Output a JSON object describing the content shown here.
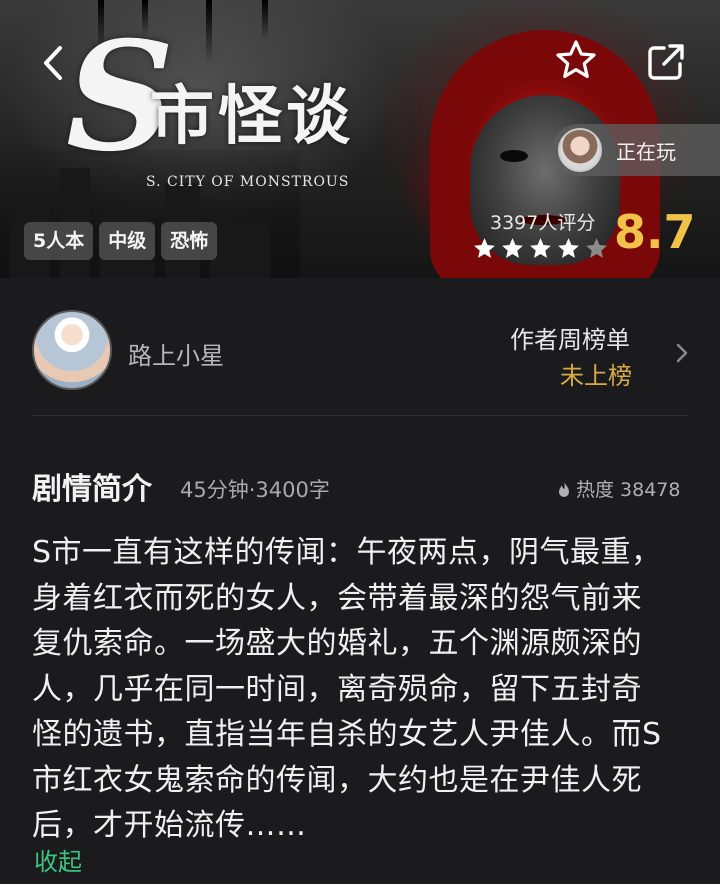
{
  "cover": {
    "logo_letter": "S",
    "logo_chinese": "市怪谈",
    "logo_english": "S. CITY OF MONSTROUS"
  },
  "header": {
    "back_icon": "chevron-left-icon",
    "favorite_icon": "star-outline-icon",
    "share_icon": "share-external-icon"
  },
  "now_playing": {
    "label": "正在玩"
  },
  "tags": [
    "5人本",
    "中级",
    "恐怖"
  ],
  "rating": {
    "count_text": "3397人评分",
    "score": "8.7",
    "stars": 4,
    "stars_max": 5,
    "score_color": "#f0c24a"
  },
  "author": {
    "name": "路上小星",
    "rank_title": "作者周榜单",
    "rank_value": "未上榜",
    "rank_value_color": "#d9ab45"
  },
  "synopsis": {
    "title": "剧情简介",
    "meta": "45分钟·3400字",
    "heat_label": "热度 38478",
    "heat_icon": "flame-icon",
    "lines": [
      "S市一直有这样的传闻：午夜两点，阴气最重，",
      "身着红衣而死的女人，会带着最深的怨气前来",
      "复仇索命。一场盛大的婚礼，五个渊源颇深的",
      "人，几乎在同一时间，离奇殒命，留下五封奇",
      "怪的遗书，直指当年自杀的女艺人尹佳人。而S",
      "市红衣女鬼索命的传闻，大约也是在尹佳人死",
      "后，才开始流传……"
    ],
    "collapse_label": "收起",
    "collapse_color": "#3bc47f"
  }
}
